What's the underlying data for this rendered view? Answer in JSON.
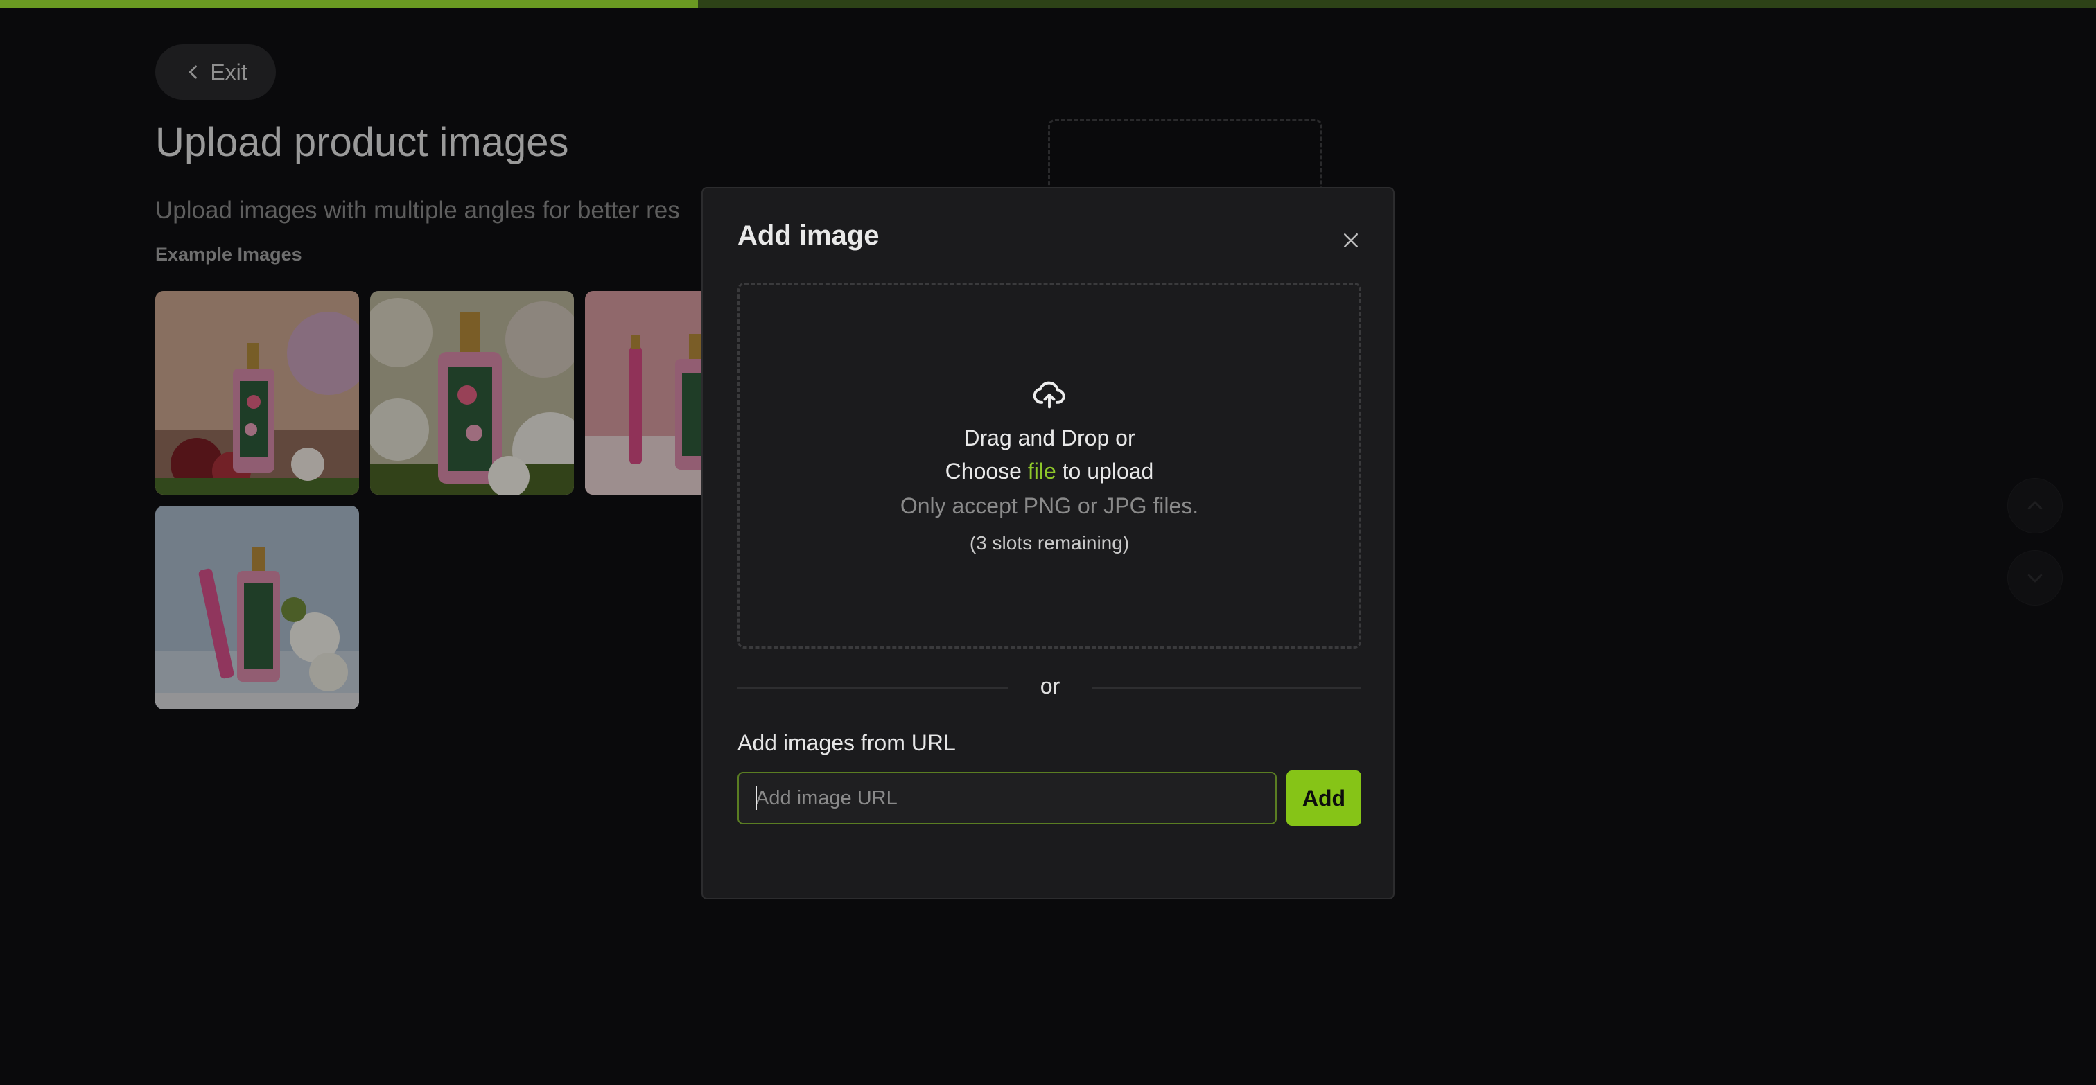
{
  "progress": {
    "fraction": 0.333
  },
  "header": {
    "exit_label": "Exit"
  },
  "page": {
    "title": "Upload product images",
    "subtitle": "Upload images with multiple angles for better res",
    "examples_label": "Example Images"
  },
  "modal": {
    "title": "Add image",
    "dropzone": {
      "line1": "Drag and Drop or",
      "choose_prefix": "Choose ",
      "choose_link": "file",
      "choose_suffix": " to upload",
      "hint": "Only accept PNG or JPG files.",
      "slots": "(3 slots remaining)"
    },
    "or_label": "or",
    "url_label": "Add images from URL",
    "url_placeholder": "Add image URL",
    "url_value": "",
    "add_button": "Add"
  },
  "colors": {
    "accent": "#86c417",
    "link": "#8fc82a",
    "progress_fill": "#6a9a22",
    "progress_track": "#2d4217"
  },
  "icons": {
    "exit": "chevron-left-icon",
    "close": "close-icon",
    "upload": "cloud-upload-icon",
    "scroll_up": "chevron-up-icon",
    "scroll_down": "chevron-down-icon"
  }
}
